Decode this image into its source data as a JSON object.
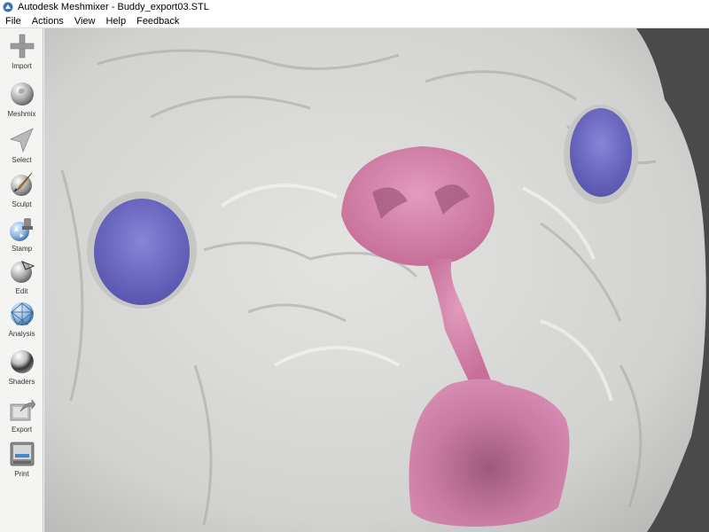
{
  "window": {
    "title": "Autodesk Meshmixer - Buddy_export03.STL",
    "icon": "meshmixer-app-icon"
  },
  "menu": [
    {
      "label": "File"
    },
    {
      "label": "Actions"
    },
    {
      "label": "View"
    },
    {
      "label": "Help"
    },
    {
      "label": "Feedback"
    }
  ],
  "toolbar": {
    "tools": [
      {
        "label": "Import",
        "icon": "plus-icon"
      },
      {
        "label": "Meshmix",
        "icon": "meshmix-sphere-icon"
      },
      {
        "label": "Select",
        "icon": "select-arrow-icon"
      },
      {
        "label": "Sculpt",
        "icon": "sculpt-brush-icon"
      },
      {
        "label": "Stamp",
        "icon": "stamp-icon"
      },
      {
        "label": "Edit",
        "icon": "edit-sphere-icon"
      },
      {
        "label": "Analysis",
        "icon": "analysis-sphere-icon"
      },
      {
        "label": "Shaders",
        "icon": "shaders-sphere-icon"
      },
      {
        "label": "Export",
        "icon": "export-icon"
      },
      {
        "label": "Print",
        "icon": "print-icon"
      }
    ]
  },
  "viewport": {
    "background_color": "#4a4a4a",
    "mesh_color": "#d8d8d6",
    "eye_color": "#6f6bc4",
    "nose_color": "#d987ad",
    "model": "3D dog face mesh"
  }
}
